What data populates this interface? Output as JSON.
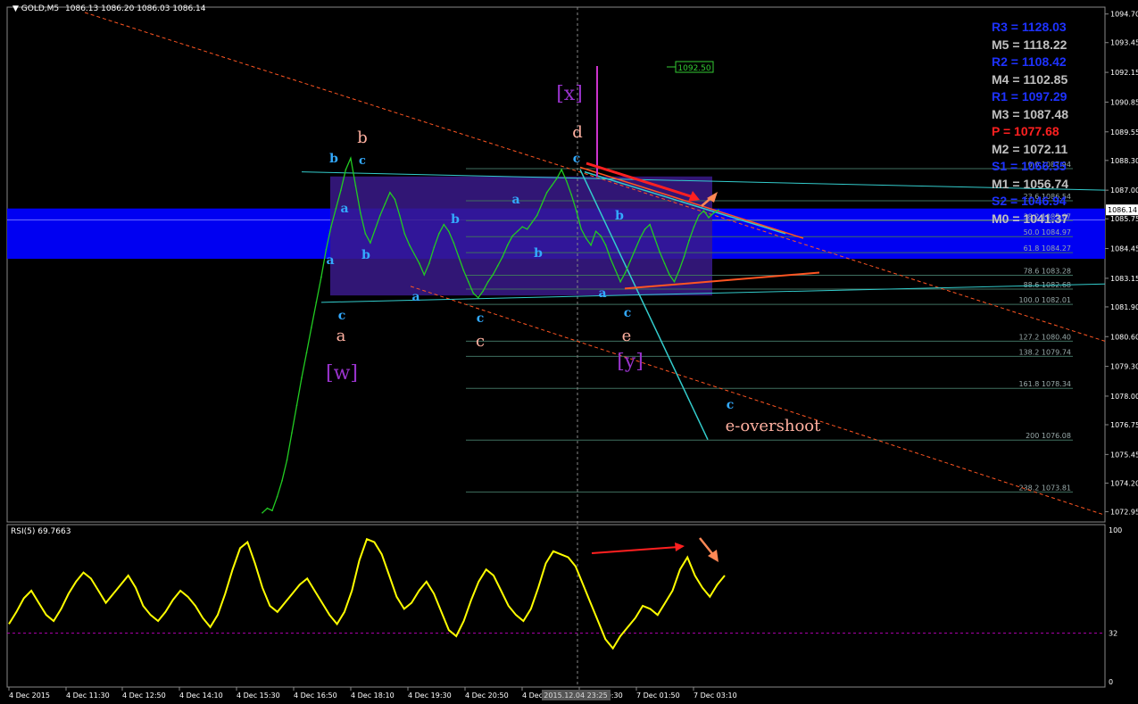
{
  "header": {
    "symbol_label": "GOLD,M5",
    "ohlc_text": "1086.13 1086.20 1086.03 1086.14"
  },
  "indicator": {
    "label": "RSI(5) 69.7663",
    "value": 69.7663,
    "levels": [
      "100",
      "32",
      "0"
    ]
  },
  "price_tag": "1086.14",
  "price_label_box": "1092.50",
  "crosshair_time": "2015.12.04 23:25",
  "colors": {
    "price_line": "#22cc22",
    "rsi_line": "#ffff00",
    "zone_blue": "#0000ff",
    "range_box": "#3a1a8a",
    "trend_orange": "#ff5522",
    "channel_cyan": "#33cccc",
    "wave_blue": "#33aaff",
    "wave_pink": "#ffb0a0",
    "wave_purple": "#9933cc",
    "pivot_blue": "#1e32ff",
    "pivot_gray": "#c0c0c0",
    "pivot_red": "#ff2020"
  },
  "pivots": [
    {
      "label": "R3",
      "value": "1128.03",
      "color": "blue"
    },
    {
      "label": "M5",
      "value": "1118.22",
      "color": "gray"
    },
    {
      "label": "R2",
      "value": "1108.42",
      "color": "blue"
    },
    {
      "label": "M4",
      "value": "1102.85",
      "color": "gray"
    },
    {
      "label": "R1",
      "value": "1097.29",
      "color": "blue"
    },
    {
      "label": "M3",
      "value": "1087.48",
      "color": "gray"
    },
    {
      "label": "P",
      "value": "1077.68",
      "color": "red"
    },
    {
      "label": "M2",
      "value": "1072.11",
      "color": "gray"
    },
    {
      "label": "S1",
      "value": "1066.55",
      "color": "blue"
    },
    {
      "label": "M1",
      "value": "1056.74",
      "color": "gray"
    },
    {
      "label": "S2",
      "value": "1046.94",
      "color": "blue"
    },
    {
      "label": "M0",
      "value": "1041.37",
      "color": "gray"
    }
  ],
  "fibonacci": [
    {
      "level": "0.0",
      "price": "1087.94"
    },
    {
      "level": "23.6",
      "price": "1086.54"
    },
    {
      "level": "38.2",
      "price": "1085.67"
    },
    {
      "level": "50.0",
      "price": "1084.97"
    },
    {
      "level": "61.8",
      "price": "1084.27"
    },
    {
      "level": "78.6",
      "price": "1083.28"
    },
    {
      "level": "88.6",
      "price": "1082.68"
    },
    {
      "level": "100.0",
      "price": "1082.01"
    },
    {
      "level": "127.2",
      "price": "1080.40"
    },
    {
      "level": "138.2",
      "price": "1079.74"
    },
    {
      "level": "161.8",
      "price": "1078.34"
    },
    {
      "level": "200",
      "price": "1076.08"
    },
    {
      "level": "238.2",
      "price": "1073.81"
    }
  ],
  "wave_labels": [
    {
      "text": "b",
      "color": "blue",
      "anchor": "top-left"
    },
    {
      "text": "c",
      "color": "blue",
      "anchor": "top-left"
    },
    {
      "text": "b",
      "color": "pink",
      "anchor": "top-left"
    },
    {
      "text": "a",
      "color": "blue",
      "anchor": "left"
    },
    {
      "text": "a",
      "color": "blue",
      "anchor": "left"
    },
    {
      "text": "b",
      "color": "blue",
      "anchor": "left"
    },
    {
      "text": "c",
      "color": "blue",
      "anchor": "left"
    },
    {
      "text": "a",
      "color": "pink",
      "anchor": "left"
    },
    {
      "text": "[w]",
      "color": "purple",
      "anchor": "left"
    },
    {
      "text": "a",
      "color": "blue",
      "anchor": "center"
    },
    {
      "text": "b",
      "color": "blue",
      "anchor": "center"
    },
    {
      "text": "a",
      "color": "blue",
      "anchor": "center"
    },
    {
      "text": "c",
      "color": "blue",
      "anchor": "center"
    },
    {
      "text": "c",
      "color": "pink",
      "anchor": "center"
    },
    {
      "text": "b",
      "color": "blue",
      "anchor": "center"
    },
    {
      "text": "[x]",
      "color": "purple",
      "anchor": "center"
    },
    {
      "text": "d",
      "color": "pink",
      "anchor": "center"
    },
    {
      "text": "c",
      "color": "blue",
      "anchor": "center"
    },
    {
      "text": "b",
      "color": "blue",
      "anchor": "center"
    },
    {
      "text": "a",
      "color": "blue",
      "anchor": "center"
    },
    {
      "text": "c",
      "color": "blue",
      "anchor": "center"
    },
    {
      "text": "e",
      "color": "pink",
      "anchor": "center"
    },
    {
      "text": "[y]",
      "color": "purple",
      "anchor": "center"
    },
    {
      "text": "c",
      "color": "blue",
      "anchor": "right"
    },
    {
      "text": "e-overshoot",
      "color": "pink",
      "anchor": "right"
    }
  ],
  "chart_data": [
    {
      "type": "line",
      "title": "GOLD,M5",
      "ylim": [
        1072.5,
        1095.0
      ],
      "y_ticks": [
        "1094.70",
        "1093.45",
        "1092.15",
        "1090.85",
        "1089.55",
        "1088.30",
        "1087.00",
        "1085.75",
        "1084.45",
        "1083.15",
        "1081.90",
        "1080.60",
        "1079.30",
        "1078.00",
        "1076.75",
        "1075.45",
        "1074.20",
        "1072.95"
      ],
      "x_ticks": [
        "4 Dec 2015",
        "4 Dec 11:30",
        "4 Dec 12:50",
        "4 Dec 14:10",
        "4 Dec 15:30",
        "4 Dec 16:50",
        "4 Dec 18:10",
        "4 Dec 19:30",
        "4 Dec 20:50",
        "4 Dec",
        "7 Dec 00:30",
        "7 Dec 01:50",
        "7 Dec 03:10"
      ],
      "series": [
        {
          "name": "GOLD,M5",
          "values": [
            1072.9,
            1073.1,
            1073.0,
            1073.6,
            1074.3,
            1075.2,
            1076.4,
            1077.6,
            1078.8,
            1079.9,
            1081.0,
            1082.1,
            1083.2,
            1084.4,
            1085.4,
            1086.2,
            1087.0,
            1087.9,
            1088.4,
            1087.2,
            1086.0,
            1085.1,
            1084.7,
            1085.3,
            1085.9,
            1086.4,
            1086.9,
            1086.6,
            1085.9,
            1085.1,
            1084.6,
            1084.2,
            1083.8,
            1083.3,
            1083.8,
            1084.5,
            1085.1,
            1085.5,
            1085.2,
            1084.7,
            1084.1,
            1083.5,
            1083.0,
            1082.5,
            1082.3,
            1082.6,
            1083.0,
            1083.3,
            1083.7,
            1084.1,
            1084.6,
            1085.0,
            1085.2,
            1085.4,
            1085.3,
            1085.6,
            1085.9,
            1086.4,
            1086.9,
            1087.2,
            1087.5,
            1087.9,
            1087.4,
            1086.8,
            1086.1,
            1085.3,
            1084.9,
            1084.6,
            1085.2,
            1085.0,
            1084.6,
            1084.0,
            1083.5,
            1083.0,
            1083.4,
            1083.9,
            1084.4,
            1084.9,
            1085.3,
            1085.5,
            1084.9,
            1084.3,
            1083.8,
            1083.3,
            1083.0,
            1083.5,
            1084.1,
            1084.8,
            1085.4,
            1085.9,
            1086.1,
            1085.8,
            1086.0,
            1086.14
          ]
        }
      ]
    },
    {
      "type": "line",
      "title": "RSI(5) 69.7663",
      "ylim": [
        0,
        100
      ],
      "y_ticks": [
        "100",
        "32",
        "0"
      ],
      "series": [
        {
          "name": "RSI(5)",
          "values": [
            38,
            46,
            55,
            60,
            52,
            44,
            40,
            48,
            58,
            66,
            72,
            68,
            60,
            52,
            58,
            64,
            70,
            62,
            50,
            44,
            40,
            46,
            54,
            60,
            56,
            50,
            42,
            36,
            44,
            58,
            74,
            88,
            92,
            78,
            62,
            50,
            46,
            52,
            58,
            64,
            68,
            60,
            52,
            44,
            38,
            46,
            60,
            80,
            94,
            92,
            84,
            70,
            56,
            48,
            52,
            60,
            66,
            58,
            46,
            34,
            30,
            40,
            54,
            66,
            74,
            70,
            60,
            50,
            44,
            40,
            48,
            62,
            78,
            86,
            84,
            82,
            76,
            64,
            52,
            40,
            28,
            22,
            30,
            36,
            42,
            50,
            48,
            44,
            52,
            60,
            74,
            82,
            70,
            62,
            56,
            64,
            70
          ]
        }
      ]
    }
  ]
}
